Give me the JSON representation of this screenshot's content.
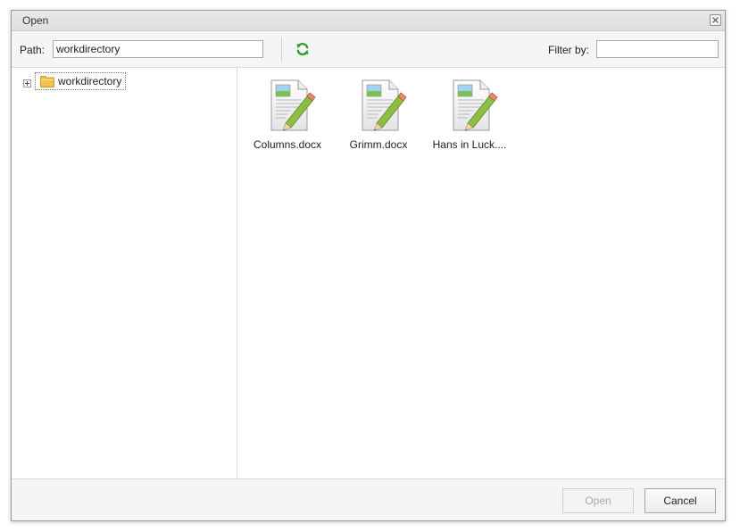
{
  "dialog": {
    "title": "Open",
    "close_icon": "close-icon"
  },
  "toolbar": {
    "path_label": "Path:",
    "path_value": "workdirectory",
    "refresh_icon": "refresh-icon",
    "refresh_color": "#2e9a2e",
    "filter_label": "Filter by:",
    "filter_value": ""
  },
  "tree": {
    "expander_icon": "plus-expander-icon",
    "folder_icon": "folder-icon",
    "folder_color": "#f2c14e",
    "root_label": "workdirectory"
  },
  "files": [
    {
      "name": "Columns.docx",
      "icon": "document-edit-icon"
    },
    {
      "name": "Grimm.docx",
      "icon": "document-edit-icon"
    },
    {
      "name": "Hans in Luck....",
      "icon": "document-edit-icon"
    }
  ],
  "footer": {
    "open_label": "Open",
    "open_enabled": false,
    "cancel_label": "Cancel"
  }
}
